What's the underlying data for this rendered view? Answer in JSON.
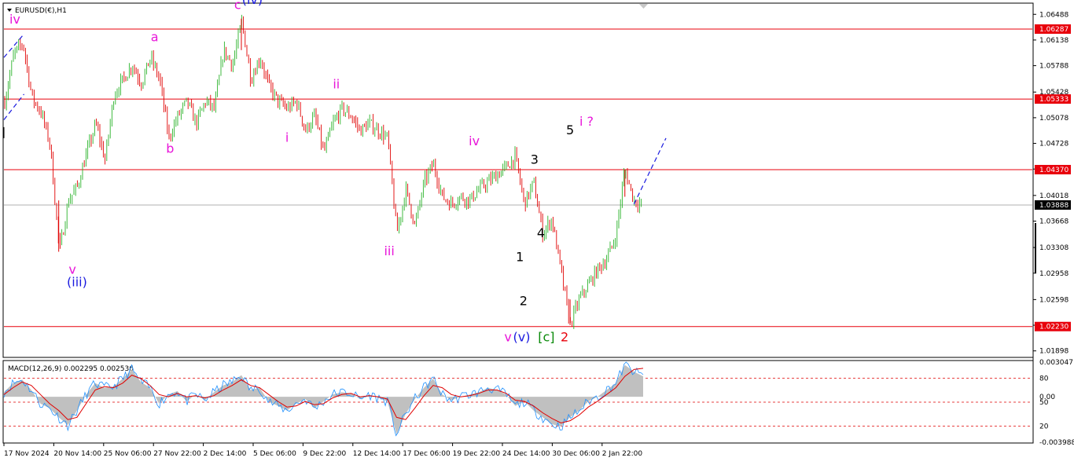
{
  "chart_header": {
    "symbol": "EURUSD(€),H1"
  },
  "macd_header": {
    "label": "MACD(12,26,9) 0.002295 0.002536"
  },
  "chart_data": [
    {
      "type": "candlestick",
      "symbol": "EURUSD",
      "timeframe": "H1",
      "ylim": [
        1.0182,
        1.0663
      ],
      "y_ticks": [
        "1.06488",
        "1.06138",
        "1.05788",
        "1.05428",
        "1.05078",
        "1.04728",
        "1.04378",
        "1.04018",
        "1.03668",
        "1.03308",
        "1.02958",
        "1.02598",
        "1.02248",
        "1.01898"
      ],
      "x_ticks": [
        "17 Nov 2024",
        "20 Nov 14:00",
        "25 Nov 06:00",
        "27 Nov 22:00",
        "2 Dec 14:00",
        "5 Dec 06:00",
        "9 Dec 22:00",
        "12 Dec 14:00",
        "17 Dec 06:00",
        "19 Dec 22:00",
        "24 Dec 14:00",
        "30 Dec 06:00",
        "2 Jan 22:00"
      ],
      "horizontal_levels": [
        {
          "value": 1.06287,
          "label": "1.06287",
          "color": "#e8000b"
        },
        {
          "value": 1.05333,
          "label": "1.05333",
          "color": "#e8000b"
        },
        {
          "value": 1.0437,
          "label": "1.04370",
          "color": "#e8000b"
        },
        {
          "value": 1.0223,
          "label": "1.02230",
          "color": "#e8000b"
        }
      ],
      "current_price": {
        "value": 1.03888,
        "label": "1.03888"
      },
      "price_path": [
        [
          0,
          1.053
        ],
        [
          1,
          1.0595
        ],
        [
          2,
          1.061
        ],
        [
          3,
          1.0535
        ],
        [
          4,
          1.0515
        ],
        [
          5,
          1.047
        ],
        [
          6,
          1.0325
        ],
        [
          7,
          1.0395
        ],
        [
          8,
          1.0415
        ],
        [
          9,
          1.046
        ],
        [
          10,
          1.05
        ],
        [
          11,
          1.045
        ],
        [
          12,
          1.054
        ],
        [
          13,
          1.056
        ],
        [
          14,
          1.058
        ],
        [
          15,
          1.0555
        ],
        [
          16,
          1.059
        ],
        [
          17,
          1.056
        ],
        [
          18,
          1.048
        ],
        [
          19,
          1.051
        ],
        [
          20,
          1.053
        ],
        [
          21,
          1.05
        ],
        [
          22,
          1.053
        ],
        [
          23,
          1.052
        ],
        [
          24,
          1.06
        ],
        [
          25,
          1.058
        ],
        [
          26,
          1.064
        ],
        [
          27,
          1.056
        ],
        [
          28,
          1.059
        ],
        [
          29,
          1.055
        ],
        [
          30,
          1.053
        ],
        [
          31,
          1.052
        ],
        [
          32,
          1.053
        ],
        [
          33,
          1.049
        ],
        [
          34,
          1.051
        ],
        [
          35,
          1.046
        ],
        [
          36,
          1.05
        ],
        [
          37,
          1.052
        ],
        [
          38,
          1.051
        ],
        [
          39,
          1.049
        ],
        [
          40,
          1.05
        ],
        [
          41,
          1.049
        ],
        [
          42,
          1.048
        ],
        [
          43,
          1.035
        ],
        [
          44,
          1.041
        ],
        [
          45,
          1.036
        ],
        [
          46,
          1.042
        ],
        [
          47,
          1.0445
        ],
        [
          48,
          1.04
        ],
        [
          49,
          1.039
        ],
        [
          50,
          1.04
        ],
        [
          51,
          1.0395
        ],
        [
          52,
          1.041
        ],
        [
          53,
          1.042
        ],
        [
          54,
          1.043
        ],
        [
          55,
          1.044
        ],
        [
          56,
          1.0455
        ],
        [
          57,
          1.039
        ],
        [
          58,
          1.042
        ],
        [
          59,
          1.035
        ],
        [
          60,
          1.037
        ],
        [
          61,
          1.03
        ],
        [
          62,
          1.0225
        ],
        [
          63,
          1.026
        ],
        [
          64,
          1.028
        ],
        [
          65,
          1.03
        ],
        [
          66,
          1.0315
        ],
        [
          67,
          1.0345
        ],
        [
          68,
          1.0437
        ],
        [
          69,
          1.0395
        ],
        [
          70,
          1.0389
        ]
      ],
      "wave_labels": [
        {
          "text": "iv",
          "x": 1.2,
          "y": 1.0636,
          "color": "#e815d9"
        },
        {
          "text": "v",
          "x": 7.5,
          "y": 1.0295,
          "color": "#e815d9"
        },
        {
          "text": "(iii)",
          "x": 8.0,
          "y": 1.0278,
          "color": "#1a1adf"
        },
        {
          "text": "a",
          "x": 16.5,
          "y": 1.0612,
          "color": "#e815d9"
        },
        {
          "text": "b",
          "x": 18.2,
          "y": 1.046,
          "color": "#e815d9"
        },
        {
          "text": "c",
          "x": 25.6,
          "y": 1.0656,
          "color": "#e815d9"
        },
        {
          "text": "(iv)",
          "x": 27.2,
          "y": 1.0663,
          "color": "#1a1adf"
        },
        {
          "text": "ii",
          "x": 36.4,
          "y": 1.0548,
          "color": "#e815d9"
        },
        {
          "text": "i",
          "x": 31.0,
          "y": 1.0475,
          "color": "#e815d9"
        },
        {
          "text": "iii",
          "x": 42.2,
          "y": 1.032,
          "color": "#e815d9"
        },
        {
          "text": "iv",
          "x": 51.5,
          "y": 1.047,
          "color": "#e815d9"
        },
        {
          "text": "v",
          "x": 55.2,
          "y": 1.0203,
          "color": "#e815d9"
        },
        {
          "text": "(v)",
          "x": 56.7,
          "y": 1.0203,
          "color": "#1a1adf"
        },
        {
          "text": "[c]",
          "x": 59.4,
          "y": 1.0203,
          "color": "#0a8a0a"
        },
        {
          "text": "2",
          "x": 61.4,
          "y": 1.0203,
          "color": "#e8000b"
        },
        {
          "text": "1",
          "x": 56.5,
          "y": 1.0312,
          "color": "#000000"
        },
        {
          "text": "2",
          "x": 56.9,
          "y": 1.0252,
          "color": "#000000"
        },
        {
          "text": "3",
          "x": 58.1,
          "y": 1.0445,
          "color": "#000000"
        },
        {
          "text": "4",
          "x": 58.8,
          "y": 1.0345,
          "color": "#000000"
        },
        {
          "text": "5",
          "x": 62.0,
          "y": 1.0485,
          "color": "#000000"
        },
        {
          "text": "i ?",
          "x": 63.8,
          "y": 1.0497,
          "color": "#e815d9"
        }
      ]
    },
    {
      "type": "area",
      "title": "MACD(12,26,9)",
      "macd": 0.002295,
      "signal": 0.002536,
      "ylim": [
        -0.003988,
        0.003047
      ],
      "y_ticks": [
        "0.003047",
        "0.00",
        "-0.003988"
      ],
      "levels": [
        {
          "value": 80,
          "label": "80"
        },
        {
          "value": 50,
          "label": "50"
        },
        {
          "value": 20,
          "label": "20"
        }
      ],
      "histogram": [
        0.0004,
        0.0012,
        0.0015,
        0.0006,
        -0.0006,
        -0.001,
        -0.0018,
        -0.0025,
        -0.0012,
        0.0002,
        0.0012,
        0.0008,
        0.0009,
        0.0016,
        0.0024,
        0.0013,
        0.0008,
        -0.0006,
        0.0002,
        0.0005,
        -0.0004,
        0.0002,
        -0.0003,
        0.0004,
        0.001,
        0.0013,
        0.0019,
        0.0006,
        0.0008,
        -0.0004,
        -0.0008,
        -0.0012,
        -0.0006,
        -0.0002,
        -0.001,
        -0.0004,
        0.0002,
        0.0004,
        0.0003,
        -0.0002,
        0.0002,
        -0.0001,
        -0.0004,
        -0.0033,
        -0.0015,
        -0.0002,
        0.0008,
        0.0016,
        0.0002,
        -0.0003,
        0.0,
        0.0002,
        0.0004,
        0.0008,
        0.0006,
        0.0002,
        -0.0008,
        -0.0004,
        -0.0012,
        -0.0018,
        -0.0024,
        -0.0026,
        -0.0018,
        -0.0012,
        -0.0004,
        0.0,
        0.0006,
        0.0012,
        0.0028,
        0.0022,
        0.0018
      ],
      "signal_line": [
        0.0002,
        0.0008,
        0.0013,
        0.001,
        0.0002,
        -0.0006,
        -0.0012,
        -0.002,
        -0.0018,
        -0.0006,
        0.0006,
        0.0009,
        0.0008,
        0.0012,
        0.0019,
        0.0016,
        0.001,
        0.0002,
        0.0,
        0.0003,
        0.0,
        0.0001,
        -0.0001,
        0.0001,
        0.0006,
        0.001,
        0.0015,
        0.001,
        0.0008,
        0.0002,
        -0.0004,
        -0.0009,
        -0.0008,
        -0.0004,
        -0.0007,
        -0.0006,
        -0.0001,
        0.0002,
        0.0003,
        0.0,
        0.0001,
        0.0,
        -0.0002,
        -0.0018,
        -0.002,
        -0.001,
        0.0001,
        0.001,
        0.0008,
        0.0002,
        0.0,
        0.0001,
        0.0003,
        0.0006,
        0.0006,
        0.0003,
        -0.0003,
        -0.0004,
        -0.0008,
        -0.0014,
        -0.0019,
        -0.0023,
        -0.0021,
        -0.0016,
        -0.0009,
        -0.0004,
        0.0002,
        0.0008,
        0.0018,
        0.0024,
        0.0025
      ]
    }
  ]
}
